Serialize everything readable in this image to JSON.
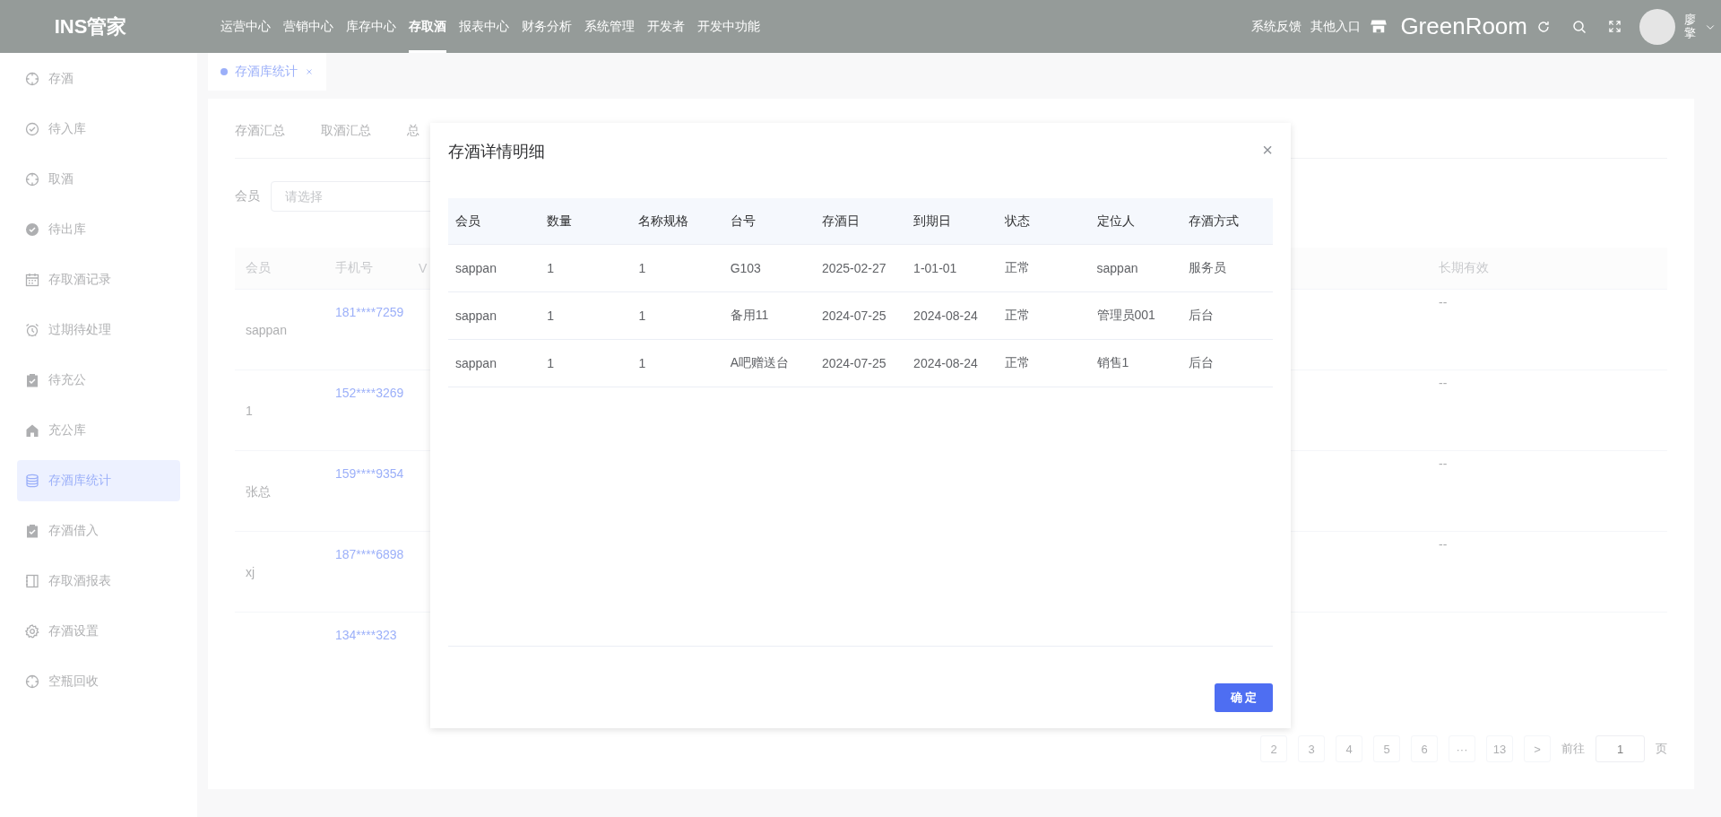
{
  "header": {
    "logo": "INS管家",
    "nav": [
      {
        "label": "运营中心",
        "selected": false
      },
      {
        "label": "营销中心",
        "selected": false
      },
      {
        "label": "库存中心",
        "selected": false
      },
      {
        "label": "存取酒",
        "selected": true
      },
      {
        "label": "报表中心",
        "selected": false
      },
      {
        "label": "财务分析",
        "selected": false
      },
      {
        "label": "系统管理",
        "selected": false
      },
      {
        "label": "开发者",
        "selected": false
      },
      {
        "label": "开发中功能",
        "selected": false
      }
    ],
    "links": [
      "系统反馈",
      "其他入口"
    ],
    "store_name": "GreenRoom",
    "user_name": "廖擎"
  },
  "sidebar": {
    "items": [
      {
        "label": "存酒",
        "selected": false
      },
      {
        "label": "待入库",
        "selected": false
      },
      {
        "label": "取酒",
        "selected": false
      },
      {
        "label": "待出库",
        "selected": false
      },
      {
        "label": "存取酒记录",
        "selected": false
      },
      {
        "label": "过期待处理",
        "selected": false
      },
      {
        "label": "待充公",
        "selected": false
      },
      {
        "label": "充公库",
        "selected": false
      },
      {
        "label": "存酒库统计",
        "selected": true
      },
      {
        "label": "存酒借入",
        "selected": false
      },
      {
        "label": "存取酒报表",
        "selected": false
      },
      {
        "label": "存酒设置",
        "selected": false
      },
      {
        "label": "空瓶回收",
        "selected": false
      }
    ]
  },
  "tag_tabs": [
    {
      "label": "存酒库统计",
      "selected": true
    }
  ],
  "card": {
    "tabs": [
      "存酒汇总",
      "取酒汇总",
      "总"
    ],
    "filter": {
      "label": "会员",
      "placeholder": "请选择"
    },
    "table": {
      "columns": [
        "会员",
        "手机号",
        "V"
      ],
      "column_last": "长期有效",
      "rows": [
        {
          "member": "sappan",
          "phone": "181****7259",
          "column_last": "--"
        },
        {
          "member": "1",
          "phone": "152****3269",
          "column_last": "--"
        },
        {
          "member": "张总",
          "phone": "159****9354",
          "column_last": "--"
        },
        {
          "member": "xj",
          "phone": "187****6898",
          "column_last": "--"
        },
        {
          "phone": "134****323"
        }
      ]
    },
    "pagination": {
      "pages": [
        "2",
        "3",
        "4",
        "5",
        "6",
        "···",
        "13"
      ],
      "next": ">",
      "goto_label": "前往",
      "goto_value": "1",
      "page_unit": "页"
    }
  },
  "dialog": {
    "title": "存酒详情明细",
    "close": "×",
    "columns": [
      "会员",
      "数量",
      "名称规格",
      "台号",
      "存酒日",
      "到期日",
      "状态",
      "定位人",
      "存酒方式"
    ],
    "rows": [
      [
        "sappan",
        "1",
        "1",
        "G103",
        "2025-02-27",
        "1-01-01",
        "正常",
        "sappan",
        "服务员"
      ],
      [
        "sappan",
        "1",
        "1",
        "备用11",
        "2024-07-25",
        "2024-08-24",
        "正常",
        "管理员001",
        "后台"
      ],
      [
        "sappan",
        "1",
        "1",
        "A吧赠送台",
        "2024-07-25",
        "2024-08-24",
        "正常",
        "销售1",
        "后台"
      ]
    ],
    "confirm": "确 定"
  }
}
